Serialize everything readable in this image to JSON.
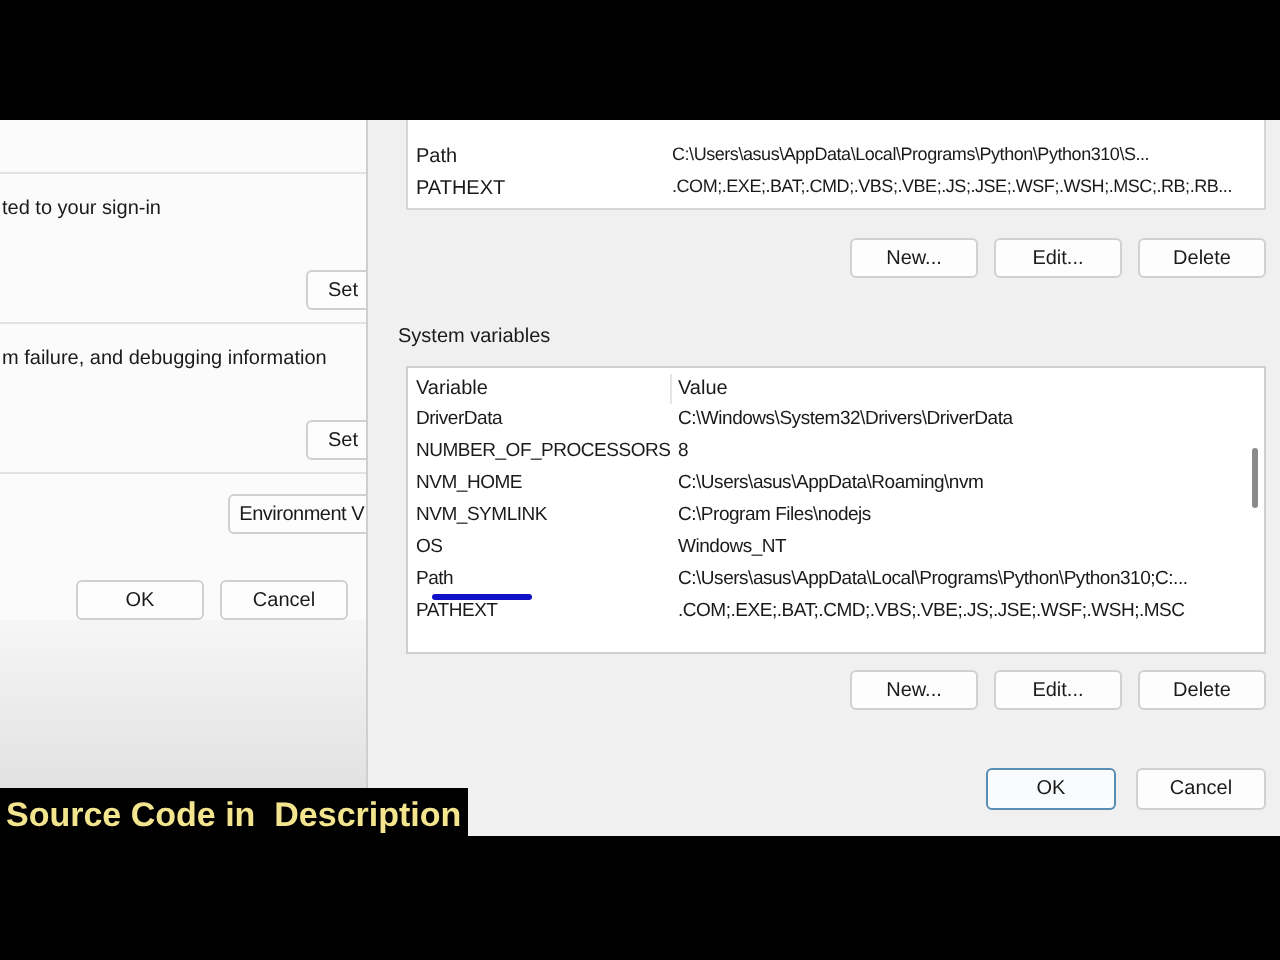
{
  "back_dialog": {
    "sections": [
      {
        "description": "ted to your sign-in",
        "button": "Set"
      },
      {
        "description": "m failure, and debugging information",
        "button": "Set"
      }
    ],
    "environment_button": "Environment V",
    "buttons": [
      "OK",
      "Cancel"
    ]
  },
  "env_dialog": {
    "user_variables": {
      "rows": [
        {
          "variable": "Path",
          "value": "C:\\Users\\asus\\AppData\\Local\\Programs\\Python\\Python310\\S..."
        },
        {
          "variable": "PATHEXT",
          "value": ".COM;.EXE;.BAT;.CMD;.VBS;.VBE;.JS;.JSE;.WSF;.WSH;.MSC;.RB;.RB..."
        }
      ],
      "buttons": [
        "New...",
        "Edit...",
        "Delete"
      ]
    },
    "system_variables": {
      "title": "System variables",
      "columns": [
        "Variable",
        "Value"
      ],
      "rows": [
        {
          "variable": "DriverData",
          "value": "C:\\Windows\\System32\\Drivers\\DriverData",
          "underlined": false
        },
        {
          "variable": "NUMBER_OF_PROCESSORS",
          "value": "8",
          "underlined": false
        },
        {
          "variable": "NVM_HOME",
          "value": "C:\\Users\\asus\\AppData\\Roaming\\nvm",
          "underlined": false
        },
        {
          "variable": "NVM_SYMLINK",
          "value": "C:\\Program Files\\nodejs",
          "underlined": false
        },
        {
          "variable": "OS",
          "value": "Windows_NT",
          "underlined": false
        },
        {
          "variable": "Path",
          "value": "C:\\Users\\asus\\AppData\\Local\\Programs\\Python\\Python310;C:...",
          "underlined": true
        },
        {
          "variable": "PATHEXT",
          "value": ".COM;.EXE;.BAT;.CMD;.VBS;.VBE;.JS;.JSE;.WSF;.WSH;.MSC",
          "underlined": false
        }
      ],
      "buttons": [
        "New...",
        "Edit...",
        "Delete"
      ]
    },
    "buttons": [
      {
        "label": "OK",
        "default": true
      },
      {
        "label": "Cancel",
        "default": false
      }
    ]
  },
  "caption": "Source Code in  Description"
}
